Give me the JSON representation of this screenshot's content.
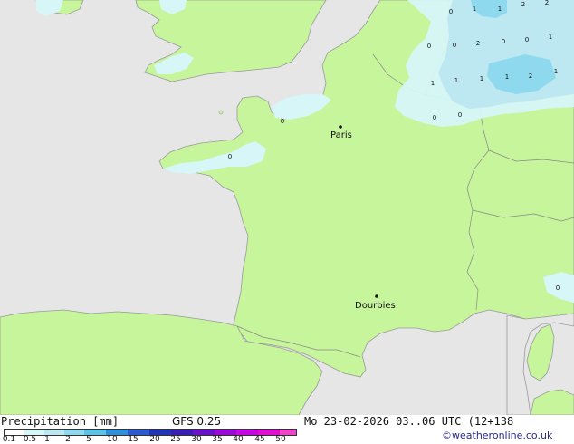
{
  "map": {
    "cities": [
      {
        "name": "Paris"
      },
      {
        "name": "Dourbies"
      }
    ],
    "cell_values": [
      "0",
      "1",
      "1",
      "2",
      "2",
      "2",
      "0",
      "0",
      "0",
      "1",
      "1",
      "1",
      "1",
      "2",
      "1",
      "0",
      "0",
      "0",
      "0",
      "0",
      "1",
      "0"
    ],
    "colors": {
      "sea": "#e6e6e6",
      "land": "#c6f59b",
      "coast": "#9a9a9a",
      "border": "#888888",
      "precip_light": "#d6f6f8",
      "precip_mid": "#bde8f2",
      "precip_strong": "#8fd9ee"
    }
  },
  "legend": {
    "title": "Precipitation [mm]",
    "model": "GFS 0.25",
    "ticks": [
      "0.1",
      "0.5",
      "1",
      "2",
      "5",
      "10",
      "15",
      "20",
      "25",
      "30",
      "35",
      "40",
      "45",
      "50"
    ],
    "swatches": [
      "#ffffff",
      "#d6f6f8",
      "#bde8f2",
      "#8fd9ee",
      "#5cc3e6",
      "#2f8fd9",
      "#2c5bd0",
      "#2235b5",
      "#3a1fb5",
      "#6a12c8",
      "#9a0ad6",
      "#c40ae0",
      "#e010d0",
      "#f044c8"
    ]
  },
  "valid_time": "Mo 23-02-2026 03..06 UTC (12+138",
  "credit": "©weatheronline.co.uk"
}
